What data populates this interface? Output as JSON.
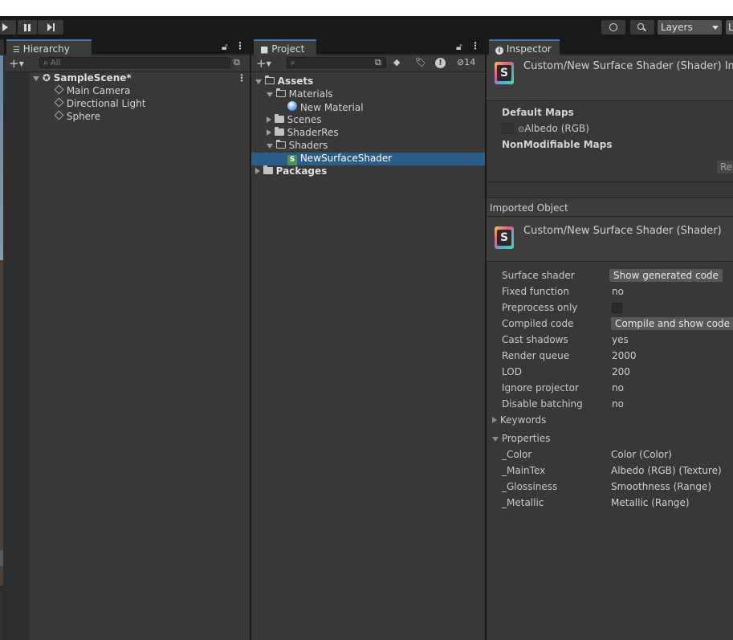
{
  "toolbar": {
    "play_icon": "play-icon",
    "pause_icon": "pause-icon",
    "step_icon": "step-icon",
    "history_icon": "history-icon",
    "search_icon": "search-icon",
    "layers_label": "Layers",
    "layout_label_cut": "L"
  },
  "hierarchy": {
    "tab_label": "Hierarchy",
    "add_label": "+",
    "search_placeholder": "All",
    "items": [
      {
        "label": "SampleScene*",
        "bold": true
      },
      {
        "label": "Main Camera"
      },
      {
        "label": "Directional Light"
      },
      {
        "label": "Sphere"
      }
    ]
  },
  "project": {
    "tab_label": "Project",
    "add_label": "+",
    "hidden_count": "14",
    "tree": [
      {
        "label": "Assets"
      },
      {
        "label": "Materials"
      },
      {
        "label": "New Material"
      },
      {
        "label": "Scenes"
      },
      {
        "label": "ShaderRes"
      },
      {
        "label": "Shaders"
      },
      {
        "label": "NewSurfaceShader"
      },
      {
        "label": "Packages"
      }
    ]
  },
  "inspector": {
    "tab_label": "Inspector",
    "header_title": "Custom/New Surface Shader (Shader) Imp",
    "default_maps_label": "Default Maps",
    "albedo_label": "Albedo (RGB)",
    "nonmodifiable_label": "NonModifiable Maps",
    "revert_cut": "Re",
    "imported_object_label": "Imported Object",
    "object_title": "Custom/New Surface Shader (Shader)",
    "rows": [
      {
        "label": "Surface shader",
        "value": "Show generated code"
      },
      {
        "label": "Fixed function",
        "value": "no"
      },
      {
        "label": "Preprocess only",
        "value": ""
      },
      {
        "label": "Compiled code",
        "value": "Compile and show code"
      },
      {
        "label": "Cast shadows",
        "value": "yes"
      },
      {
        "label": "Render queue",
        "value": "2000"
      },
      {
        "label": "LOD",
        "value": "200"
      },
      {
        "label": "Ignore projector",
        "value": "no"
      },
      {
        "label": "Disable batching",
        "value": "no"
      }
    ],
    "keywords_label": "Keywords",
    "properties_label": "Properties",
    "properties": [
      {
        "name": "_Color",
        "value": "Color (Color)"
      },
      {
        "name": "_MainTex",
        "value": "Albedo (RGB) (Texture)"
      },
      {
        "name": "_Glossiness",
        "value": "Smoothness (Range)"
      },
      {
        "name": "_Metallic",
        "value": "Metallic (Range)"
      }
    ]
  }
}
